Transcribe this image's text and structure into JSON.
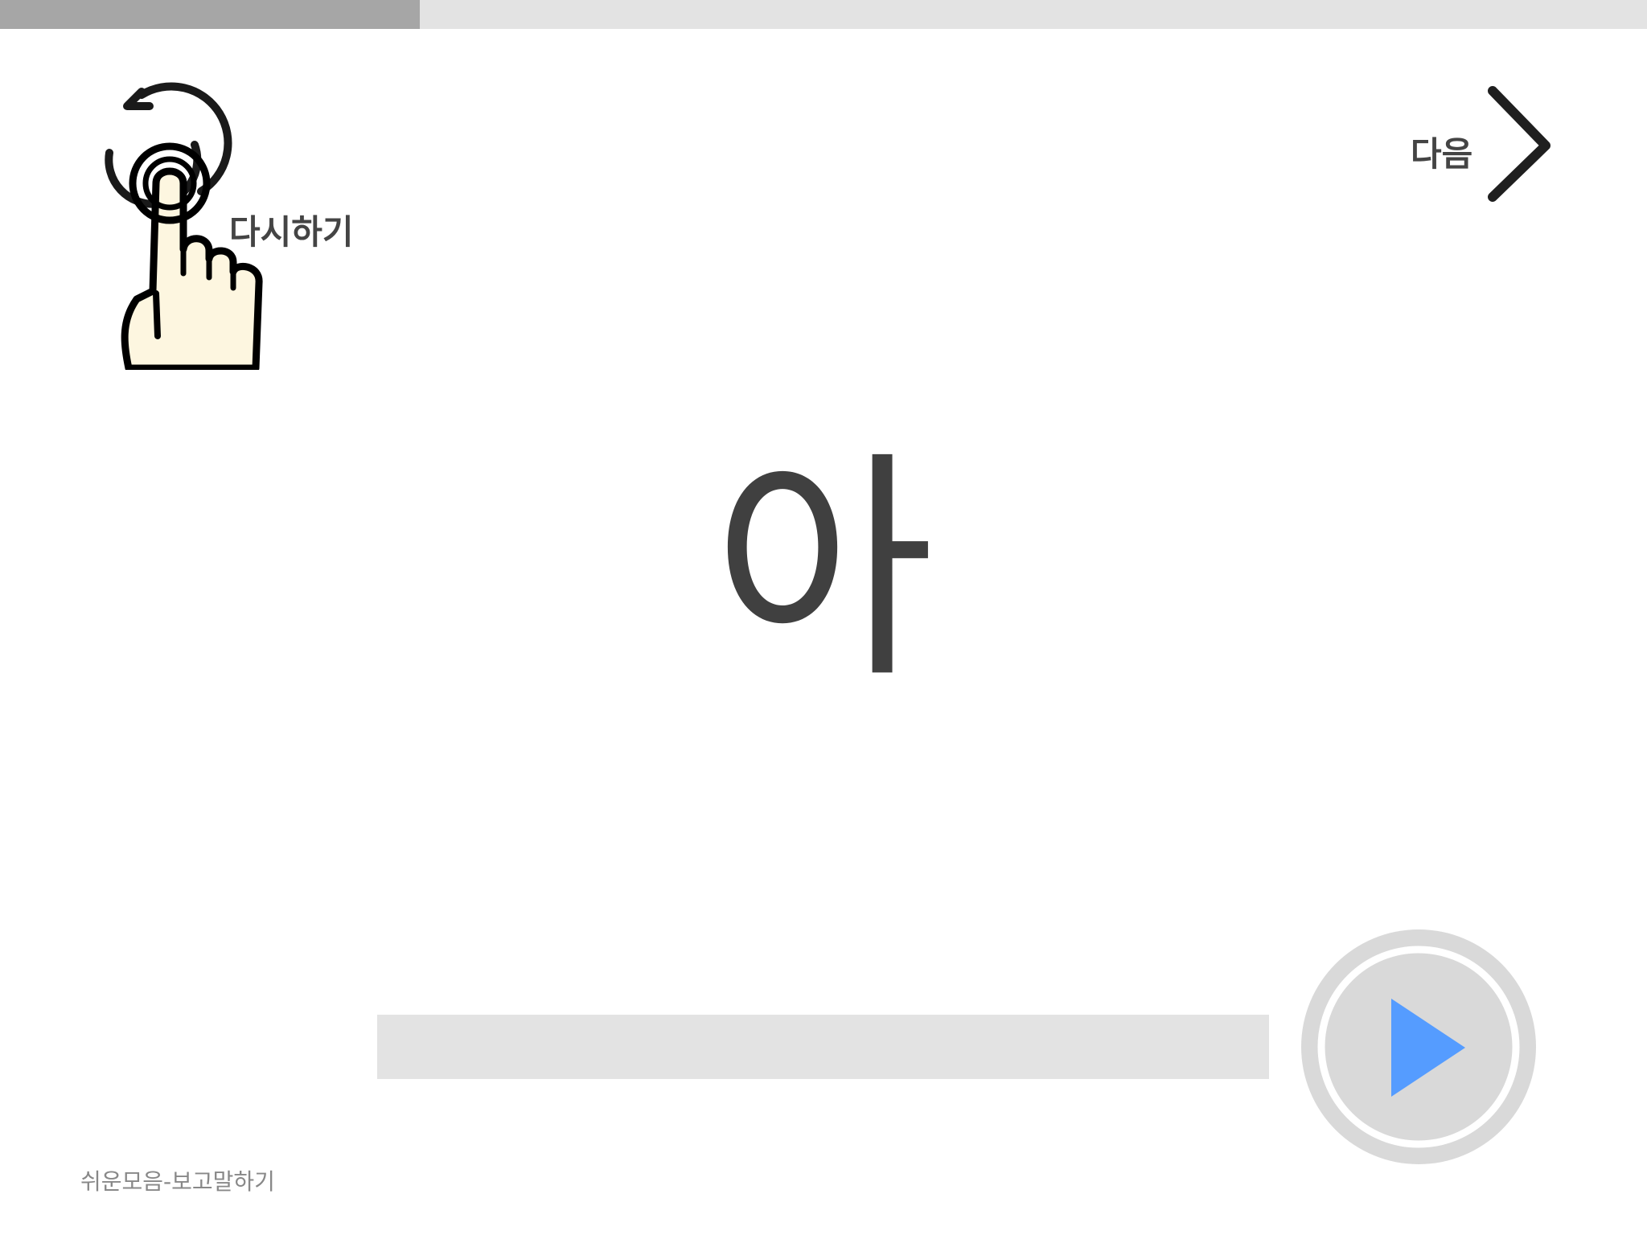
{
  "lesson_progress": 0.255,
  "header": {
    "replay_label": "다시하기",
    "replay_icon": "tap-replay-hand-icon",
    "next_label": "다음",
    "next_icon": "chevron-right-icon"
  },
  "main": {
    "syllable": "아"
  },
  "audio": {
    "progress": 0,
    "play_icon": "play-icon",
    "play_color": "#559cff"
  },
  "footer": {
    "caption": "쉬운모음-보고말하기"
  },
  "colors": {
    "progress_fill": "#a6a6a6",
    "progress_track": "#e3e3e3",
    "text_dark": "#404040",
    "caption": "#888888",
    "hand_fill": "#fdf6e0"
  }
}
